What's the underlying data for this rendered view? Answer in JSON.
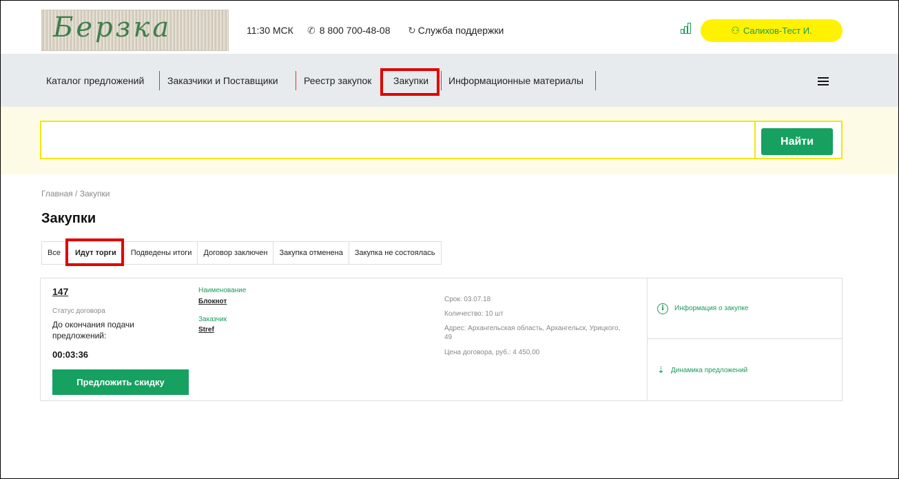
{
  "header": {
    "logo_text": "Берзка",
    "time": "11:30 МСК",
    "phone": "8 800 700-48-08",
    "support": "Служба поддержки",
    "user": "Салихов-Тест И."
  },
  "nav": {
    "items": [
      {
        "label": "Каталог предложений"
      },
      {
        "label": "Заказчики и Поставщики"
      },
      {
        "label": "Реестр закупок"
      },
      {
        "label": "Закупки"
      },
      {
        "label": "Информационные материалы"
      }
    ]
  },
  "search": {
    "value": "",
    "button": "Найти"
  },
  "breadcrumb": {
    "home": "Главная",
    "sep": " / ",
    "current": "Закупки"
  },
  "page": {
    "title": "Закупки"
  },
  "tabs": [
    {
      "label": "Все"
    },
    {
      "label": "Идут торги"
    },
    {
      "label": "Подведены итоги"
    },
    {
      "label": "Договор заключен"
    },
    {
      "label": "Закупка отменена"
    },
    {
      "label": "Закупка не состоялась"
    }
  ],
  "card": {
    "number": "147",
    "status_label": "Статус договора",
    "deadline_text": "До окончания подачи предложений:",
    "timer": "00:03:36",
    "offer_button": "Предложить скидку",
    "name_label": "Наименование",
    "name_value": "Блокнот",
    "customer_label": "Заказчик",
    "customer_value": "Stref",
    "term": "Срок: 03.07.18",
    "quantity": "Количество: 10 шт",
    "address": "Адрес: Архангельская область, Архангельск, Урицкого, 49",
    "price": "Цена договора, руб.: 4 450,00",
    "info_link": "Информация о закупке",
    "dynamics_link": "Динамика предложений"
  },
  "colors": {
    "accent_green": "#16a161",
    "accent_yellow": "#fff200",
    "highlight_red": "#e00000",
    "nav_bg": "#e8ebed",
    "search_bg": "#fdfbe5"
  }
}
